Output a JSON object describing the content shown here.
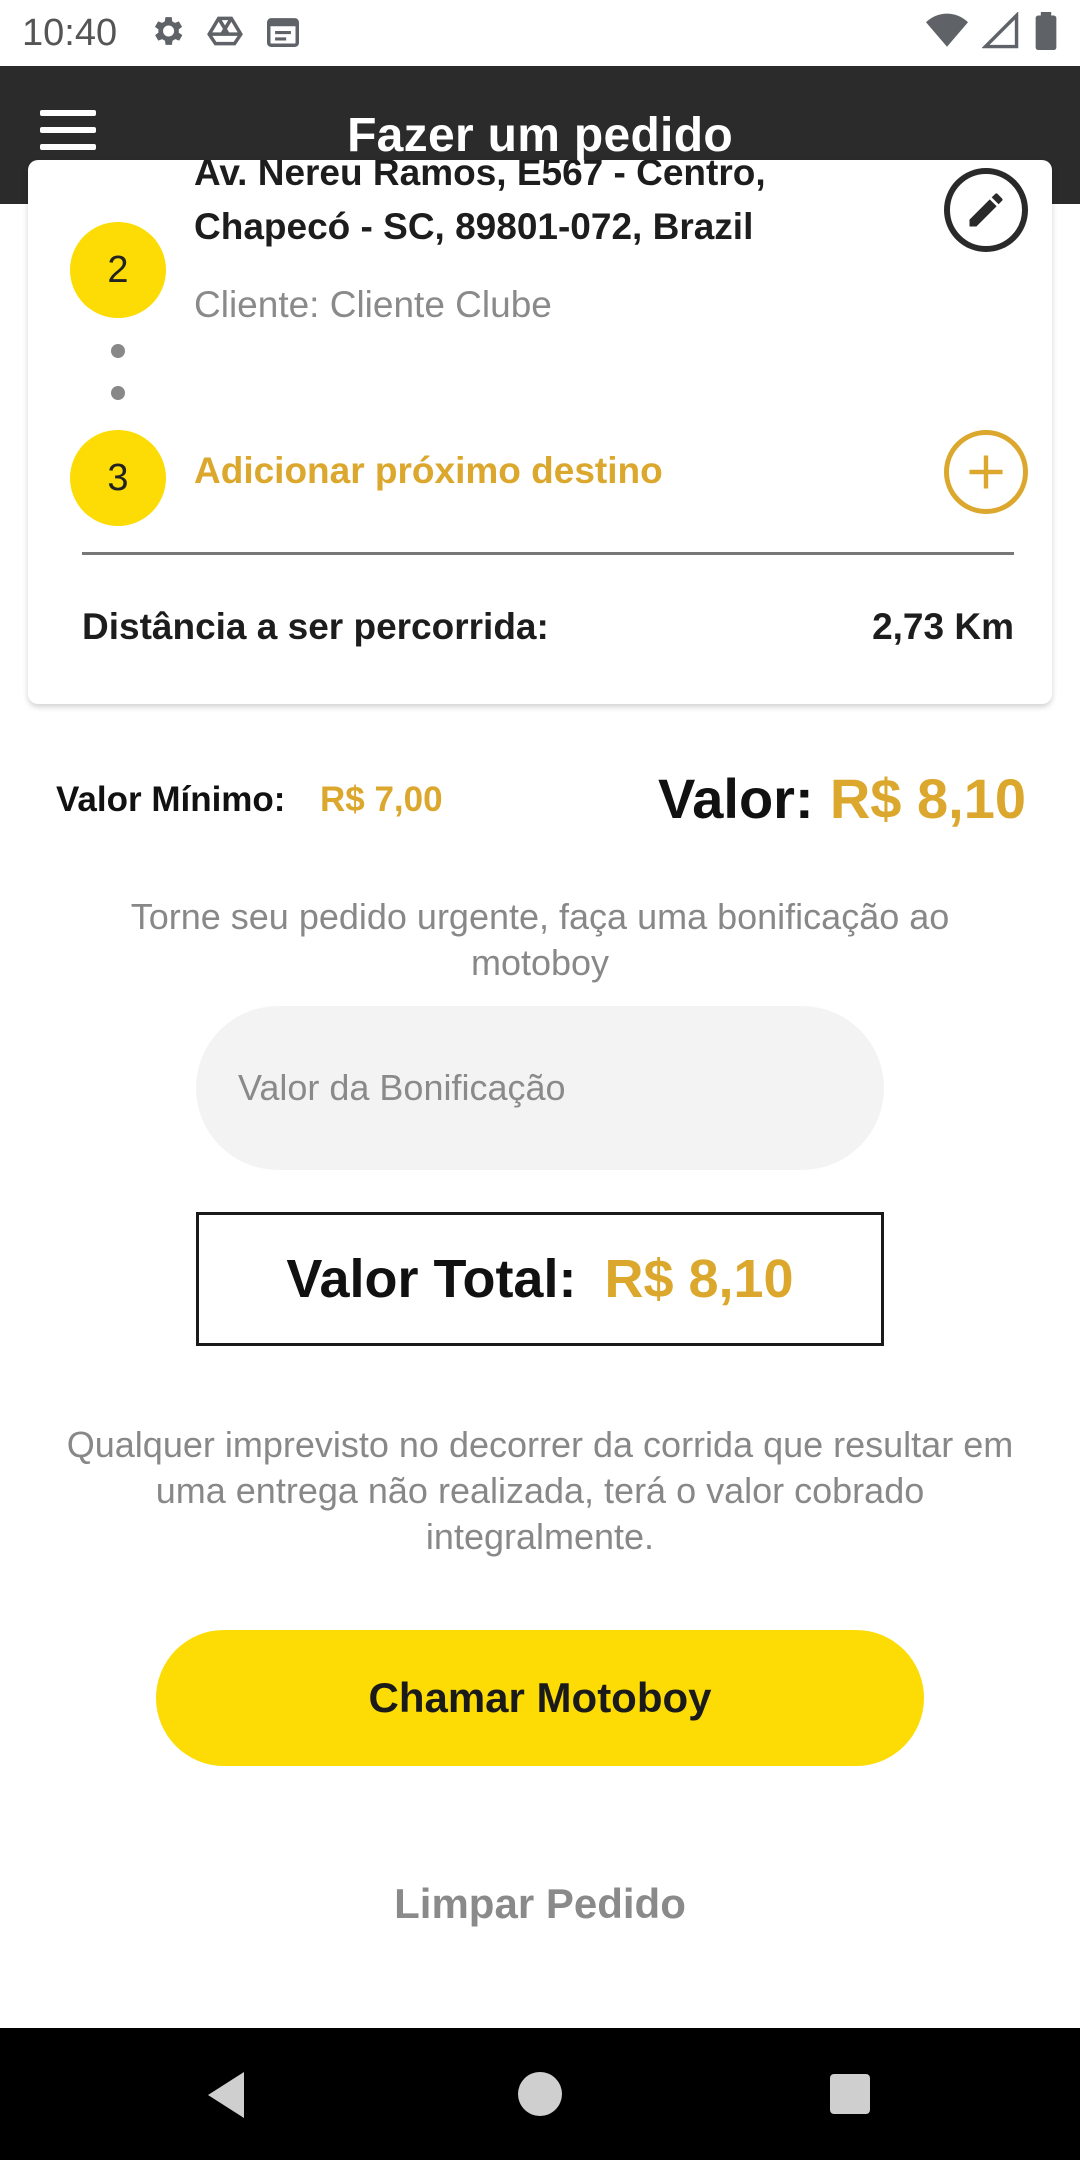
{
  "status_bar": {
    "time": "10:40",
    "left_icons": [
      "settings-icon",
      "drive-icon",
      "calendar-icon"
    ],
    "right_icons": [
      "wifi-icon",
      "cell-signal-icon",
      "battery-icon"
    ]
  },
  "app_bar": {
    "title": "Fazer um pedido",
    "menu_icon": "hamburger-menu-icon"
  },
  "route": {
    "stop2": {
      "number": "2",
      "address_line1": "Av. Nereu Ramos, E567 - Centro,",
      "address_line2": "Chapecó - SC, 89801-072, Brazil",
      "client": "Cliente: Cliente Clube"
    },
    "stop3": {
      "number": "3",
      "label": "Adicionar próximo destino"
    },
    "distance_label": "Distância a ser percorrida:",
    "distance_value": "2,73 Km"
  },
  "pricing": {
    "min_label": "Valor Mínimo:",
    "min_value": "R$ 7,00",
    "value_label": "Valor:",
    "value": "R$ 8,10",
    "urgent_text": "Torne seu pedido urgente, faça uma bonificação ao motoboy",
    "bonus_placeholder": "Valor da Bonificação",
    "bonus_value": "",
    "total_label": "Valor Total:",
    "total_value": "R$ 8,10"
  },
  "disclaimer": "Qualquer imprevisto no decorrer da corrida que resultar em uma entrega não realizada, terá o valor cobrado integralmente.",
  "actions": {
    "call_label": "Chamar Motoboy",
    "clear_label": "Limpar Pedido"
  },
  "colors": {
    "accent_yellow": "#fcdc04",
    "accent_gold": "#dba72d",
    "app_bar": "#2b2b2b"
  }
}
